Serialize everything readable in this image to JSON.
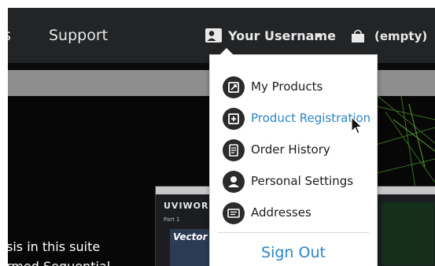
{
  "nav": {
    "partial_item": "s",
    "support": "Support",
    "username": "Your Username",
    "cart": "(empty)"
  },
  "menu": {
    "items": [
      {
        "label": "My Products",
        "icon": "my-products-icon"
      },
      {
        "label": "Product Registration",
        "icon": "product-registration-icon",
        "active": true
      },
      {
        "label": "Order History",
        "icon": "order-history-icon"
      },
      {
        "label": "Personal Settings",
        "icon": "personal-settings-icon"
      },
      {
        "label": "Addresses",
        "icon": "addresses-icon"
      }
    ],
    "sign_out": "Sign Out"
  },
  "background": {
    "line1": "sis in this suite",
    "line2": "rmed Sequential",
    "app_logo": "UVIWORKSTA",
    "app_part": "Part 1",
    "app_panel": "Vector P"
  },
  "colors": {
    "navbar": "#222426",
    "accent": "#2a86c8",
    "menu_icon": "#2b2b2b"
  }
}
